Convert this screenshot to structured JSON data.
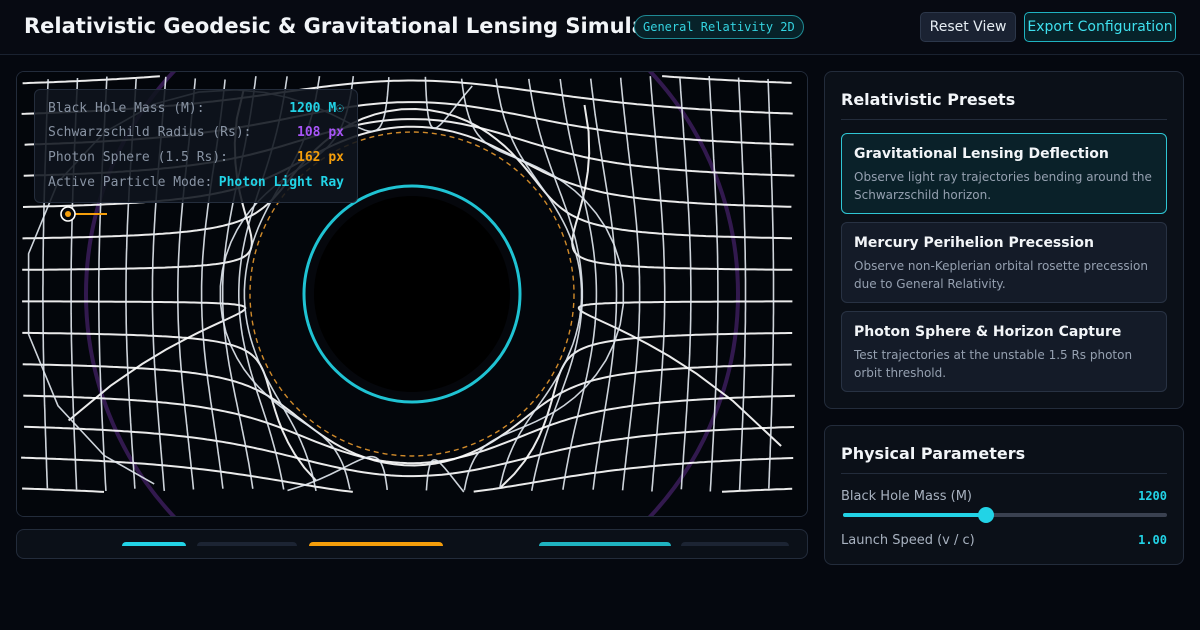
{
  "header": {
    "title": "Relativistic Geodesic & Gravitational Lensing Simulator",
    "badge": "General Relativity 2D",
    "reset_label": "Reset View",
    "export_label": "Export Configuration"
  },
  "readout": [
    {
      "label": "Black Hole Mass (M):",
      "value": "1200 M☉",
      "color": "#22d3e6"
    },
    {
      "label": "Schwarzschild Radius (Rs):",
      "value": "108 px",
      "color": "#a855f7"
    },
    {
      "label": "Photon Sphere (1.5 Rs):",
      "value": "162 px",
      "color": "#f59e0b"
    },
    {
      "label": "Active Particle Mode:",
      "value": "Photon Light Ray",
      "color": "#22d3e6"
    }
  ],
  "presets": {
    "title": "Relativistic Presets",
    "items": [
      {
        "name": "Gravitational Lensing Deflection",
        "description": "Observe light ray trajectories bending around the Schwarzschild horizon.",
        "active": true
      },
      {
        "name": "Mercury Perihelion Precession",
        "description": "Observe non-Keplerian orbital rosette precession due to General Relativity.",
        "active": false
      },
      {
        "name": "Photon Sphere & Horizon Capture",
        "description": "Test trajectories at the unstable 1.5 Rs photon orbit threshold.",
        "active": false
      }
    ]
  },
  "parameters": {
    "title": "Physical Parameters",
    "items": [
      {
        "label": "Black Hole Mass (M)",
        "value": "1200",
        "fraction": 0.44
      },
      {
        "label": "Launch Speed (v / c)",
        "value": "1.00",
        "fraction": 1.0
      }
    ]
  },
  "colors": {
    "accent": "#22d3e6",
    "horizon": "#1fc3d3",
    "photon_sphere": "#d08a2a",
    "schwarzschild": "#a855f7",
    "emitter": "#f59e0b"
  }
}
